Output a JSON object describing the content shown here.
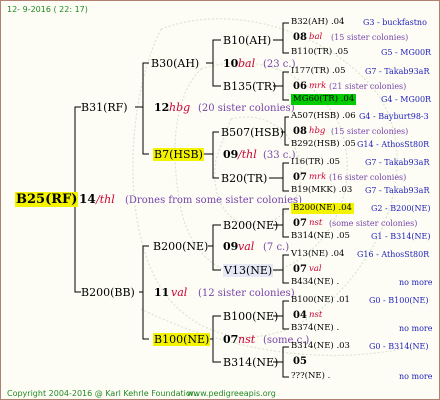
{
  "header": {
    "date": "12- 9-2016 ( 22: 17)"
  },
  "footer": {
    "copyright": "Copyright 2004-2016 @ Karl Kehrle Foundation.",
    "site": "www.pedigreeapis.org"
  },
  "root": {
    "id": "B25(RF)",
    "gen": "14",
    "year": "/thl",
    "note": "(Drones from some sister colonies)"
  },
  "gen1": [
    {
      "id": "B31(RF)",
      "gen": "12",
      "year": "hbg",
      "note": "(20 sister colonies)"
    },
    {
      "id": "B200(BB)",
      "gen": "11",
      "year": "val",
      "note": "(12 sister colonies)"
    }
  ],
  "gen2": [
    {
      "id": "B30(AH)",
      "gen": "10",
      "year": "bal",
      "note": "(23 c.)"
    },
    {
      "id": "B7(HSB)",
      "gen": "09",
      "year": "/thl",
      "note": "(33 c.)"
    },
    {
      "id": "B200(NE)",
      "gen": "09",
      "year": "val",
      "note": "(7 c.)"
    },
    {
      "id": "B100(NE)",
      "gen": "07",
      "year": "nst",
      "note": "(some c.)"
    }
  ],
  "gen3": [
    {
      "id": "B10(AH)"
    },
    {
      "id": "B135(TR)"
    },
    {
      "id": "B507(HSB)"
    },
    {
      "id": "B20(TR)"
    },
    {
      "id": "B200(NE)"
    },
    {
      "id": "V13(NE)"
    },
    {
      "id": "B100(NE)"
    },
    {
      "id": "B314(NE)"
    }
  ],
  "gen4": [
    {
      "l1": "B32(AH) .04",
      "l1r": "G3 - buckfastno",
      "gen": "08",
      "year": "bal",
      "note": "(15 sister colonies)",
      "l3": "B110(TR) .05",
      "l3r": "G5 - MG00R"
    },
    {
      "l1": "I177(TR) .05",
      "l1r": "G7 - Takab93aR",
      "gen": "06",
      "year": "mrk",
      "note": "(21 sister colonies)",
      "l3": "MG60(TR) .04",
      "l3r": "G4 - MG00R"
    },
    {
      "l1": "A507(HSB) .06",
      "l1r": "G4 - Bayburt98-3",
      "gen": "08",
      "year": "hbg",
      "note": "(15 sister colonies)",
      "l3": "B292(HSB) .05",
      "l3r": "G14 - AthosSt80R"
    },
    {
      "l1": "I16(TR) .05",
      "l1r": "G7 - Takab93aR",
      "gen": "07",
      "year": "mrk",
      "note": "(16 sister colonies)",
      "l3": "B19(MKK) .03",
      "l3r": "G7 - Takab93aR"
    },
    {
      "l1": "B200(NE) .04",
      "l1r": "G2 - B200(NE)",
      "gen": "07",
      "year": "nst",
      "note": "(some sister colonies)",
      "l3": "B314(NE) .05",
      "l3r": "G1 - B314(NE)"
    },
    {
      "l1": "V13(NE) .04",
      "l1r": "G16 - AthosSt80R",
      "gen": "07",
      "year": "val",
      "note": "",
      "l3": "B434(NE) .",
      "l3r": "no more"
    },
    {
      "l1": "B100(NE) .01",
      "l1r": "G0 - B100(NE)",
      "gen": "04",
      "year": "nst",
      "note": "",
      "l3": "B374(NE) .",
      "l3r": "no more"
    },
    {
      "l1": "B314(NE) .03",
      "l1r": "G0 - B314(NE)",
      "gen": "05",
      "year": "",
      "note": "",
      "l3": "???(NE) .",
      "l3r": "no more"
    }
  ]
}
